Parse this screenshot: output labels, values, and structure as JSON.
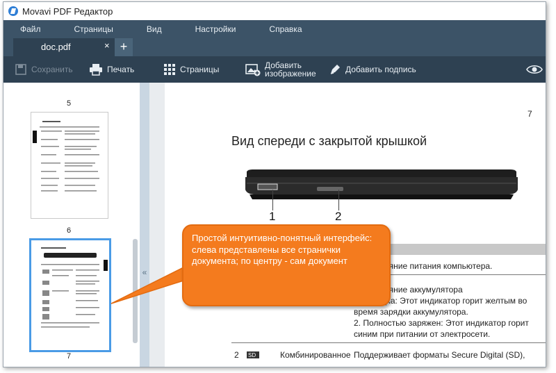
{
  "app": {
    "title": "Movavi PDF Редактор"
  },
  "menu": [
    "Файл",
    "Страницы",
    "Вид",
    "Настройки",
    "Справка"
  ],
  "tabs": [
    {
      "label": "doc.pdf",
      "close": "×"
    }
  ],
  "tab_add": "+",
  "toolbar": {
    "save": "Сохранить",
    "print": "Печать",
    "pages": "Страницы",
    "add_image_line1": "Добавить",
    "add_image_line2": "изображение",
    "add_signature": "Добавить подпись"
  },
  "sidebar": {
    "pages": [
      "5",
      "6",
      "7"
    ],
    "collapse": "«"
  },
  "document": {
    "page_number": "7",
    "heading": "Вид спереди с закрытой крышкой",
    "callout_1": "1",
    "callout_2": "2",
    "table_rows": [
      "ает состояние питания компьютера.",
      "ает состояние аккумулятора",
      "1. Зарядка: Этот индикатор горит желтым во",
      "время зарядки аккумулятора.",
      "2. Полностью заряжен: Этот индикатор горит",
      "синим при питании от электросети."
    ],
    "last_row": {
      "num": "2",
      "name": "Комбинированное",
      "desc": "Поддерживает форматы Secure Digital (SD),"
    }
  },
  "callout": {
    "text": "Простой интуитивно-понятный интерфейс: слева представлены все странички документа; по центру - сам документ"
  },
  "colors": {
    "accent": "#4a9be6",
    "callout": "#f47b1e",
    "toolbar": "#2e4152",
    "menubar": "#3c5367"
  }
}
